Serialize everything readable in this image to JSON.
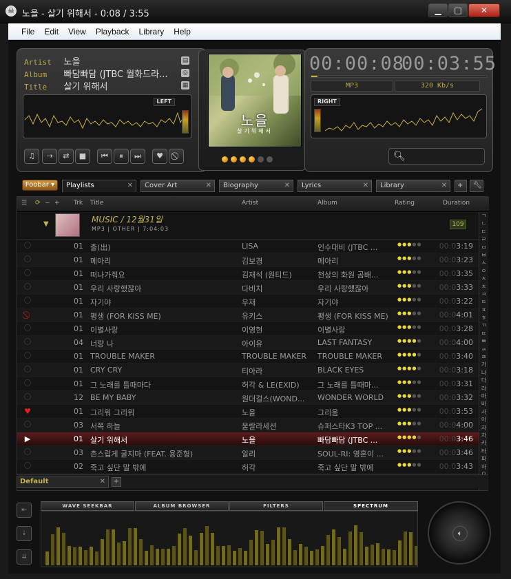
{
  "window": {
    "title": "노을 - 살기 위해서 - 0:08 / 3:55",
    "minimize_label": "▁",
    "maximize_label": "□",
    "close_label": "✕"
  },
  "menu": [
    "File",
    "Edit",
    "View",
    "Playback",
    "Library",
    "Help"
  ],
  "now_playing": {
    "artist_label": "Artist",
    "artist": "노을",
    "album_label": "Album",
    "album": "빠담빠담 (JTBC 월화드라...",
    "title_label": "Title",
    "title": "살기 위해서",
    "left_label": "LEFT",
    "right_label": "RIGHT",
    "art_title": "노을",
    "art_subtitle": "살기위해서",
    "elapsed": "00:00:08",
    "total": "00:03:55",
    "codec": "MP3",
    "bitrate": "320 Kb/s",
    "progress": 0.034
  },
  "search": {
    "placeholder": ""
  },
  "tabs": {
    "foobar": "Foobar ▾",
    "playlists": "Playlists",
    "cover_art": "Cover Art",
    "biography": "Biography",
    "lyrics": "Lyrics",
    "library": "Library",
    "close": "✕"
  },
  "playlist": {
    "columns": {
      "trk": "Trk",
      "title": "Title",
      "artist": "Artist",
      "album": "Album",
      "rating": "Rating",
      "duration": "Duration"
    },
    "group": {
      "title": "MUSIC / 12월31일",
      "subtitle": "MP3 | OTHER | 7:04:03",
      "count": "109"
    },
    "rows": [
      {
        "trk": "01",
        "title": "출(出)",
        "artist": "LISA",
        "album": "인수대비 (JTBC ...",
        "rating": 3,
        "dur_dim": "00:0",
        "dur": "3:19",
        "status": "ring"
      },
      {
        "trk": "01",
        "title": "메아리",
        "artist": "김보경",
        "album": "메아리",
        "rating": 3,
        "dur_dim": "00:0",
        "dur": "3:23",
        "status": "ring"
      },
      {
        "trk": "01",
        "title": "떠나가줘요",
        "artist": "김재석 (원티드)",
        "album": "천상의 화원 곰배...",
        "rating": 3,
        "dur_dim": "00:0",
        "dur": "3:35",
        "status": "ring"
      },
      {
        "trk": "01",
        "title": "우리 사랑했잖아",
        "artist": "다비치",
        "album": "우리 사랑했잖아",
        "rating": 3,
        "dur_dim": "00:0",
        "dur": "3:33",
        "status": "ring"
      },
      {
        "trk": "01",
        "title": "자기야",
        "artist": "우재",
        "album": "자기야",
        "rating": 3,
        "dur_dim": "00:0",
        "dur": "3:22",
        "status": "ring"
      },
      {
        "trk": "01",
        "title": "평생 (FOR KISS ME)",
        "artist": "유키스",
        "album": "평생 (FOR KISS ME)",
        "rating": 3,
        "dur_dim": "00:0",
        "dur": "4:01",
        "status": "ban"
      },
      {
        "trk": "01",
        "title": "이별사랑",
        "artist": "이영현",
        "album": "이별사랑",
        "rating": 3,
        "dur_dim": "00:0",
        "dur": "3:28",
        "status": "ring"
      },
      {
        "trk": "04",
        "title": "너랑 나",
        "artist": "아이유",
        "album": "LAST FANTASY",
        "rating": 4,
        "dur_dim": "00:0",
        "dur": "4:00",
        "status": "ring"
      },
      {
        "trk": "01",
        "title": "TROUBLE MAKER",
        "artist": "TROUBLE MAKER",
        "album": "TROUBLE MAKER",
        "rating": 4,
        "dur_dim": "00:0",
        "dur": "3:40",
        "status": "ring"
      },
      {
        "trk": "01",
        "title": "CRY CRY",
        "artist": "티아라",
        "album": "BLACK EYES",
        "rating": 4,
        "dur_dim": "00:0",
        "dur": "3:18",
        "status": "ring"
      },
      {
        "trk": "01",
        "title": "그 노래를 틀때마다",
        "artist": "허각 & LE(EXID)",
        "album": "그 노래를 틀때마...",
        "rating": 3,
        "dur_dim": "00:0",
        "dur": "3:31",
        "status": "ring"
      },
      {
        "trk": "12",
        "title": "BE MY BABY",
        "artist": "원더걸스(WOND...",
        "album": "WONDER WORLD",
        "rating": 3,
        "dur_dim": "00:0",
        "dur": "3:32",
        "status": "ring"
      },
      {
        "trk": "01",
        "title": "그리워 그리워",
        "artist": "노을",
        "album": "그리움",
        "rating": 3,
        "dur_dim": "00:0",
        "dur": "3:53",
        "status": "heart"
      },
      {
        "trk": "03",
        "title": "서쪽 하늘",
        "artist": "울랄라세션",
        "album": "슈퍼스타K3 TOP ...",
        "rating": 3,
        "dur_dim": "00:0",
        "dur": "4:00",
        "status": "ring"
      },
      {
        "trk": "01",
        "title": "살기 위해서",
        "artist": "노을",
        "album": "빠담빠담 (JTBC ...",
        "rating": 4,
        "dur_dim": "00:0",
        "dur": "3:46",
        "status": "play"
      },
      {
        "trk": "03",
        "title": "촌스럽게 굴지마 (FEAT. 용준형)",
        "artist": "알리",
        "album": "SOUL-RI: 영혼이 ...",
        "rating": 3,
        "dur_dim": "00:0",
        "dur": "3:46",
        "status": "ring"
      },
      {
        "trk": "02",
        "title": "죽고 싶단 말 밖에",
        "artist": "허각",
        "album": "죽고 싶단 말 밖에",
        "rating": 3,
        "dur_dim": "00:0",
        "dur": "3:43",
        "status": "ring"
      }
    ],
    "alphabet": [
      "ㄱ",
      "ㄴ",
      "ㄷ",
      "ㄹ",
      "ㅁ",
      "ㅂ",
      "ㅅ",
      "ㅇ",
      "ㅈ",
      "ㅊ",
      "ㅋ",
      "ㅌ",
      "ㅍ",
      "ㅎ",
      "ㄲ",
      "ㄸ",
      "ㅃ",
      "ㅆ",
      "ㅉ",
      "가",
      "나",
      "다",
      "라",
      "마",
      "바",
      "사",
      "아",
      "자",
      "차",
      "카",
      "타",
      "파",
      "하",
      "요",
      "오"
    ],
    "footer_tab": "Default",
    "add_label": "+"
  },
  "bottom": {
    "tabs": [
      "WAVE SEEKBAR",
      "ALBUM BROWSER",
      "FILTERS",
      "SPECTRUM"
    ],
    "active_tab": "SPECTRUM"
  },
  "colors": {
    "accent": "#c4b450",
    "playing_row": "#5a1c1c",
    "star": "#e8d840"
  }
}
